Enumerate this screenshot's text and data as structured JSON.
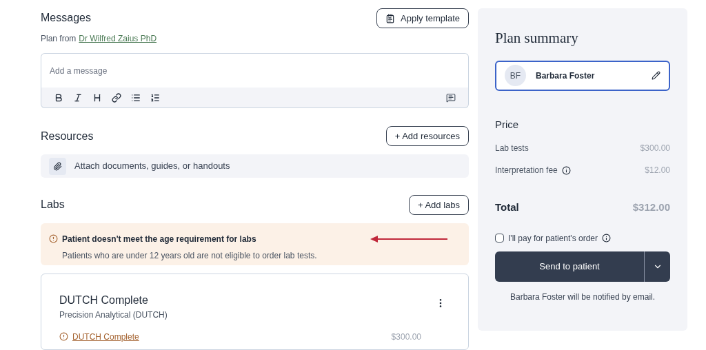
{
  "messages": {
    "title": "Messages",
    "apply_template_button": "Apply template",
    "plan_from_label": "Plan from",
    "doctor_link": "Dr Wilfred Zaius PhD",
    "message_field": {
      "placeholder": "Add a message"
    }
  },
  "resources": {
    "title": "Resources",
    "add_button": "+ Add resources",
    "attach_text": "Attach documents, guides, or handouts"
  },
  "labs": {
    "title": "Labs",
    "add_button": "+ Add labs",
    "alert": {
      "title": "Patient doesn't meet the age requirement for labs",
      "body": "Patients who are under 12 years old are not eligible to order lab tests."
    },
    "cards": [
      {
        "name": "DUTCH Complete",
        "vendor": "Precision Analytical (DUTCH)",
        "test_link": "DUTCH Complete",
        "price": "$300.00"
      }
    ]
  },
  "summary": {
    "title": "Plan summary",
    "patient": {
      "initials": "BF",
      "name": "Barbara Foster"
    },
    "price_title": "Price",
    "lines": [
      {
        "label": "Lab tests",
        "info": false,
        "amount": "$300.00"
      },
      {
        "label": "Interpretation fee",
        "info": true,
        "amount": "$12.00"
      }
    ],
    "total_label": "Total",
    "total_amount": "$312.00",
    "pay_checkbox": {
      "label": "I'll pay for patient's order",
      "checked": false
    },
    "send_button": "Send to patient",
    "note": "Barbara Foster will be notified by email."
  }
}
